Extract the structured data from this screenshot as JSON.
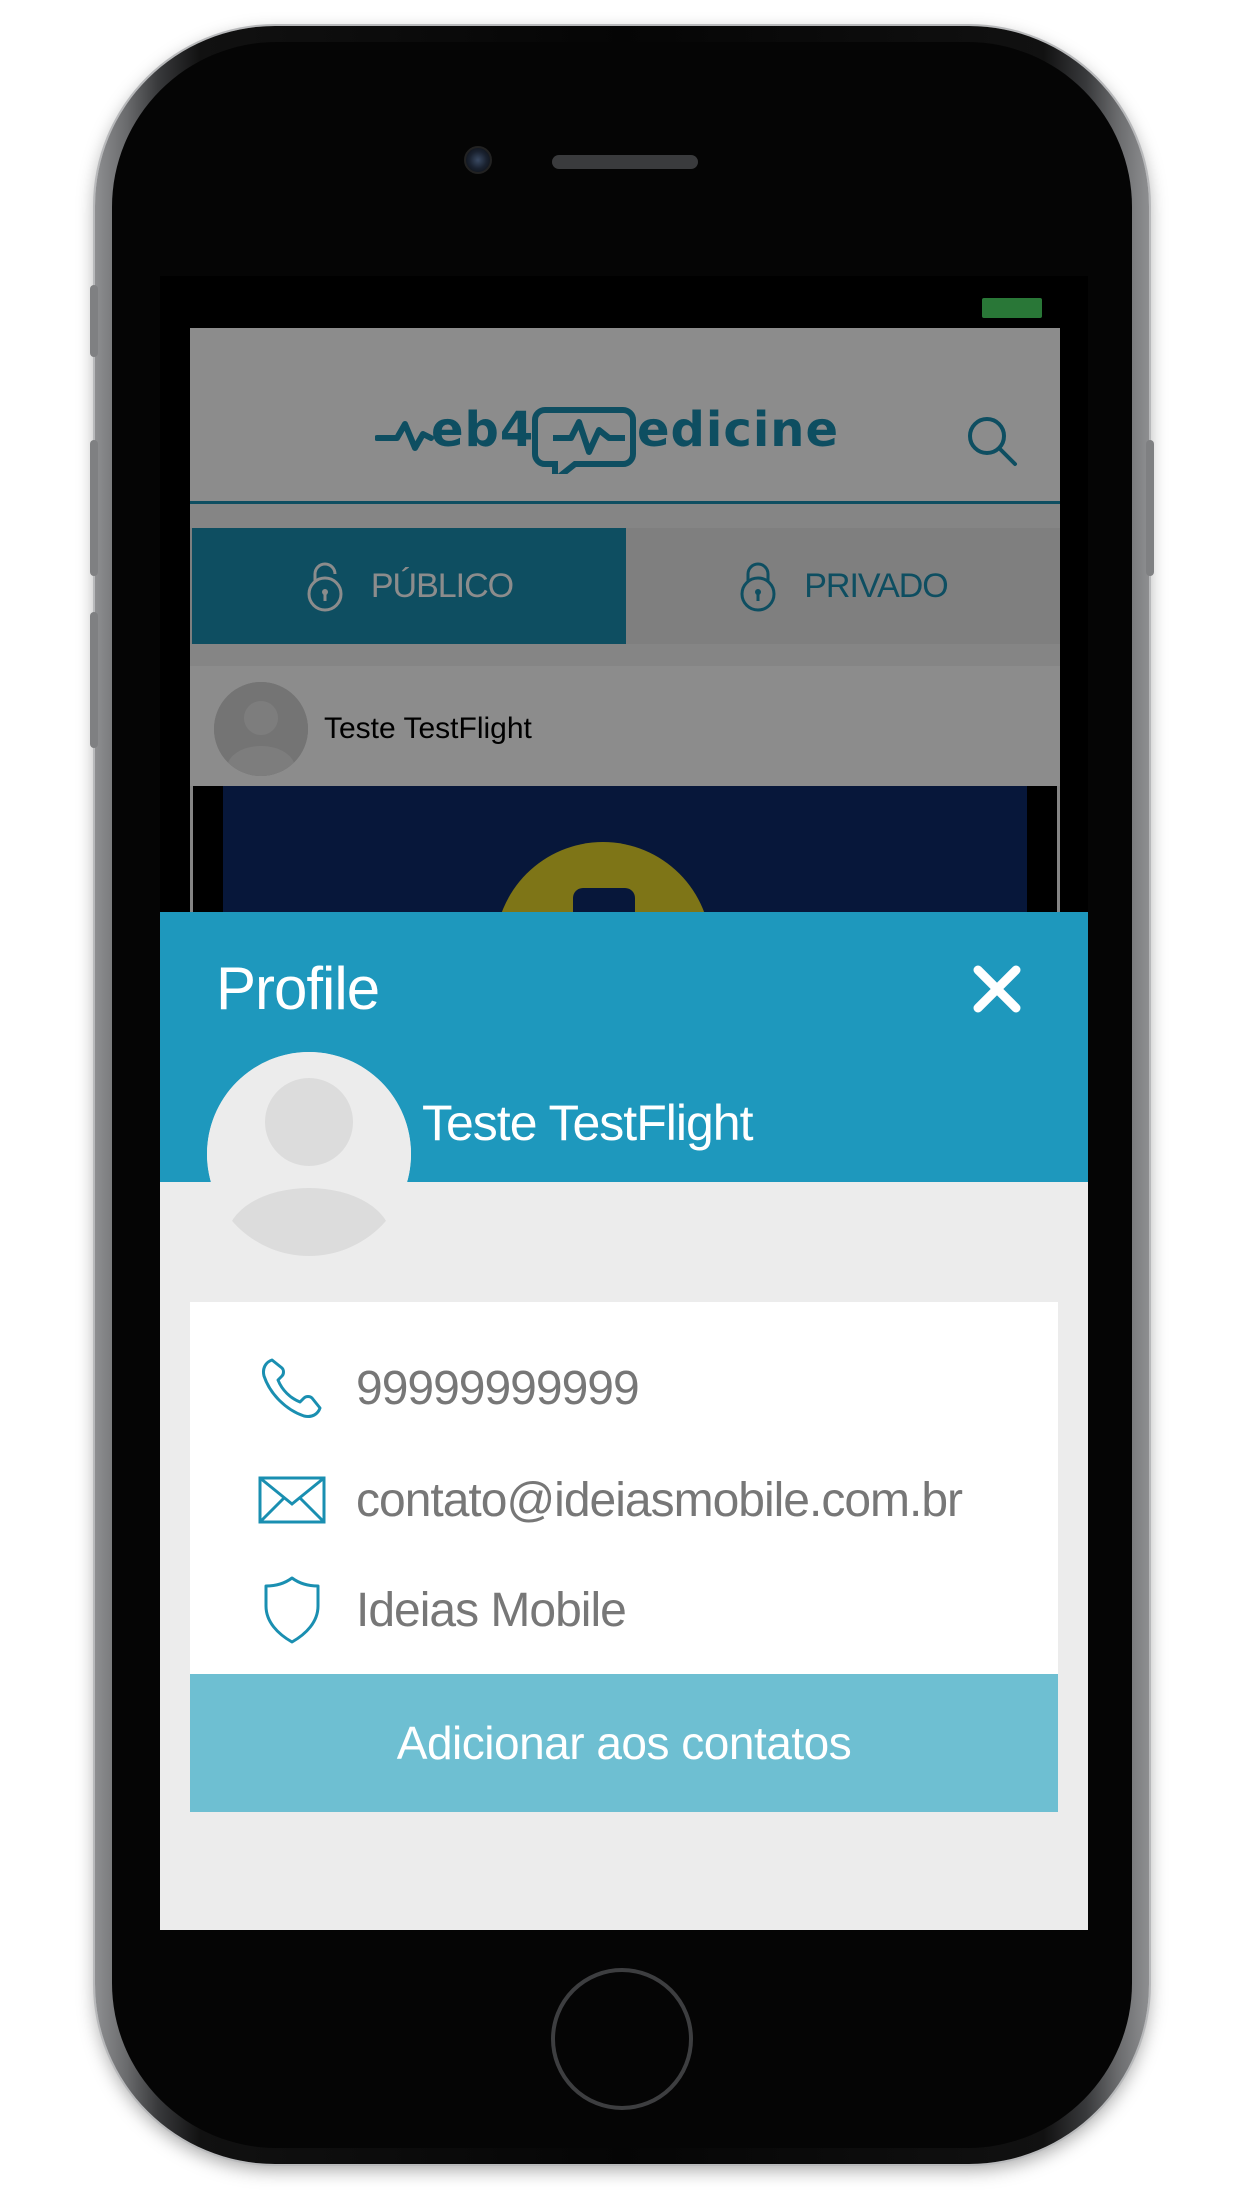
{
  "app": {
    "logo": "web4Medicine",
    "tabs": [
      {
        "label": "PÚBLICO",
        "active": true
      },
      {
        "label": "PRIVADO",
        "active": false
      }
    ],
    "feed": {
      "author": "Teste TestFlight"
    }
  },
  "profile": {
    "title": "Profile",
    "name": "Teste TestFlight",
    "phone": "99999999999",
    "email": "contato@ideiasmobile.com.br",
    "company": "Ideias Mobile",
    "add_button": "Adicionar aos contatos"
  },
  "colors": {
    "accent": "#1e98bd",
    "button": "#6ebfd2",
    "battery": "#4cd964"
  },
  "icons": [
    "search-icon",
    "lock-icon",
    "close-icon",
    "phone-icon",
    "email-icon",
    "shield-icon",
    "avatar-placeholder"
  ]
}
